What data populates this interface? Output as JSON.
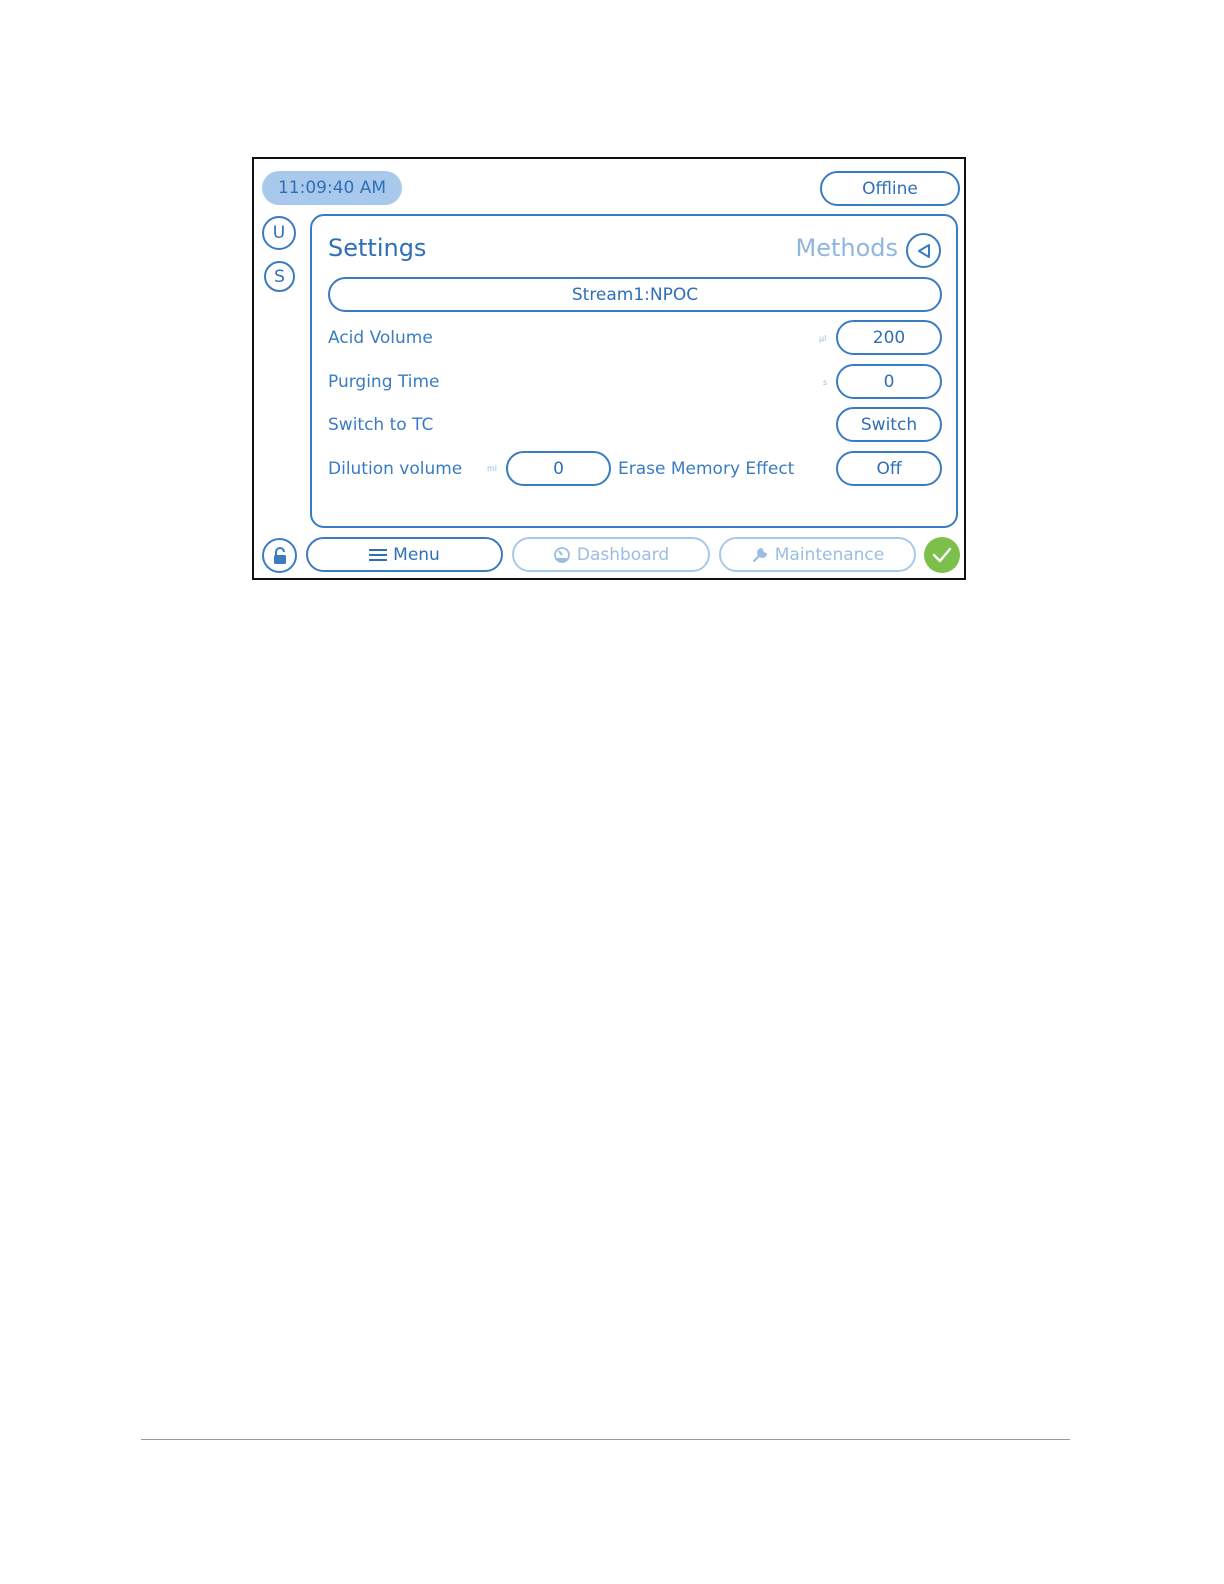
{
  "header": {
    "time": "11:09:40 AM",
    "status_button": "Offline"
  },
  "side": {
    "user_label": "U",
    "system_label": "S"
  },
  "panel": {
    "title": "Settings",
    "methods_label": "Methods",
    "stream_button": "Stream1:NPOC",
    "rows": {
      "acid_volume": {
        "label": "Acid Volume",
        "unit": "µl",
        "value": "200"
      },
      "purging_time": {
        "label": "Purging Time",
        "unit": "s",
        "value": "0"
      },
      "switch_to_tc": {
        "label": "Switch to TC",
        "button": "Switch"
      },
      "dilution_volume": {
        "label": "Dilution volume",
        "unit": "ml",
        "value": "0"
      },
      "erase_memory_effect": {
        "label": "Erase Memory Effect",
        "value": "Off"
      }
    }
  },
  "nav": {
    "menu": "Menu",
    "dashboard": "Dashboard",
    "maintenance": "Maintenance"
  },
  "colors": {
    "accent": "#3a7cc2",
    "text": "#2f6fb7",
    "inactive": "#a9c9ec",
    "clock_bg": "#a9c9ec",
    "ok_green": "#7cc04b"
  },
  "icons": {
    "lock": "lock-open-icon",
    "menu": "hamburger-icon",
    "dashboard": "gauge-icon",
    "maintenance": "wrench-icon",
    "ok": "checkmark-icon",
    "back": "triangle-left-icon"
  }
}
